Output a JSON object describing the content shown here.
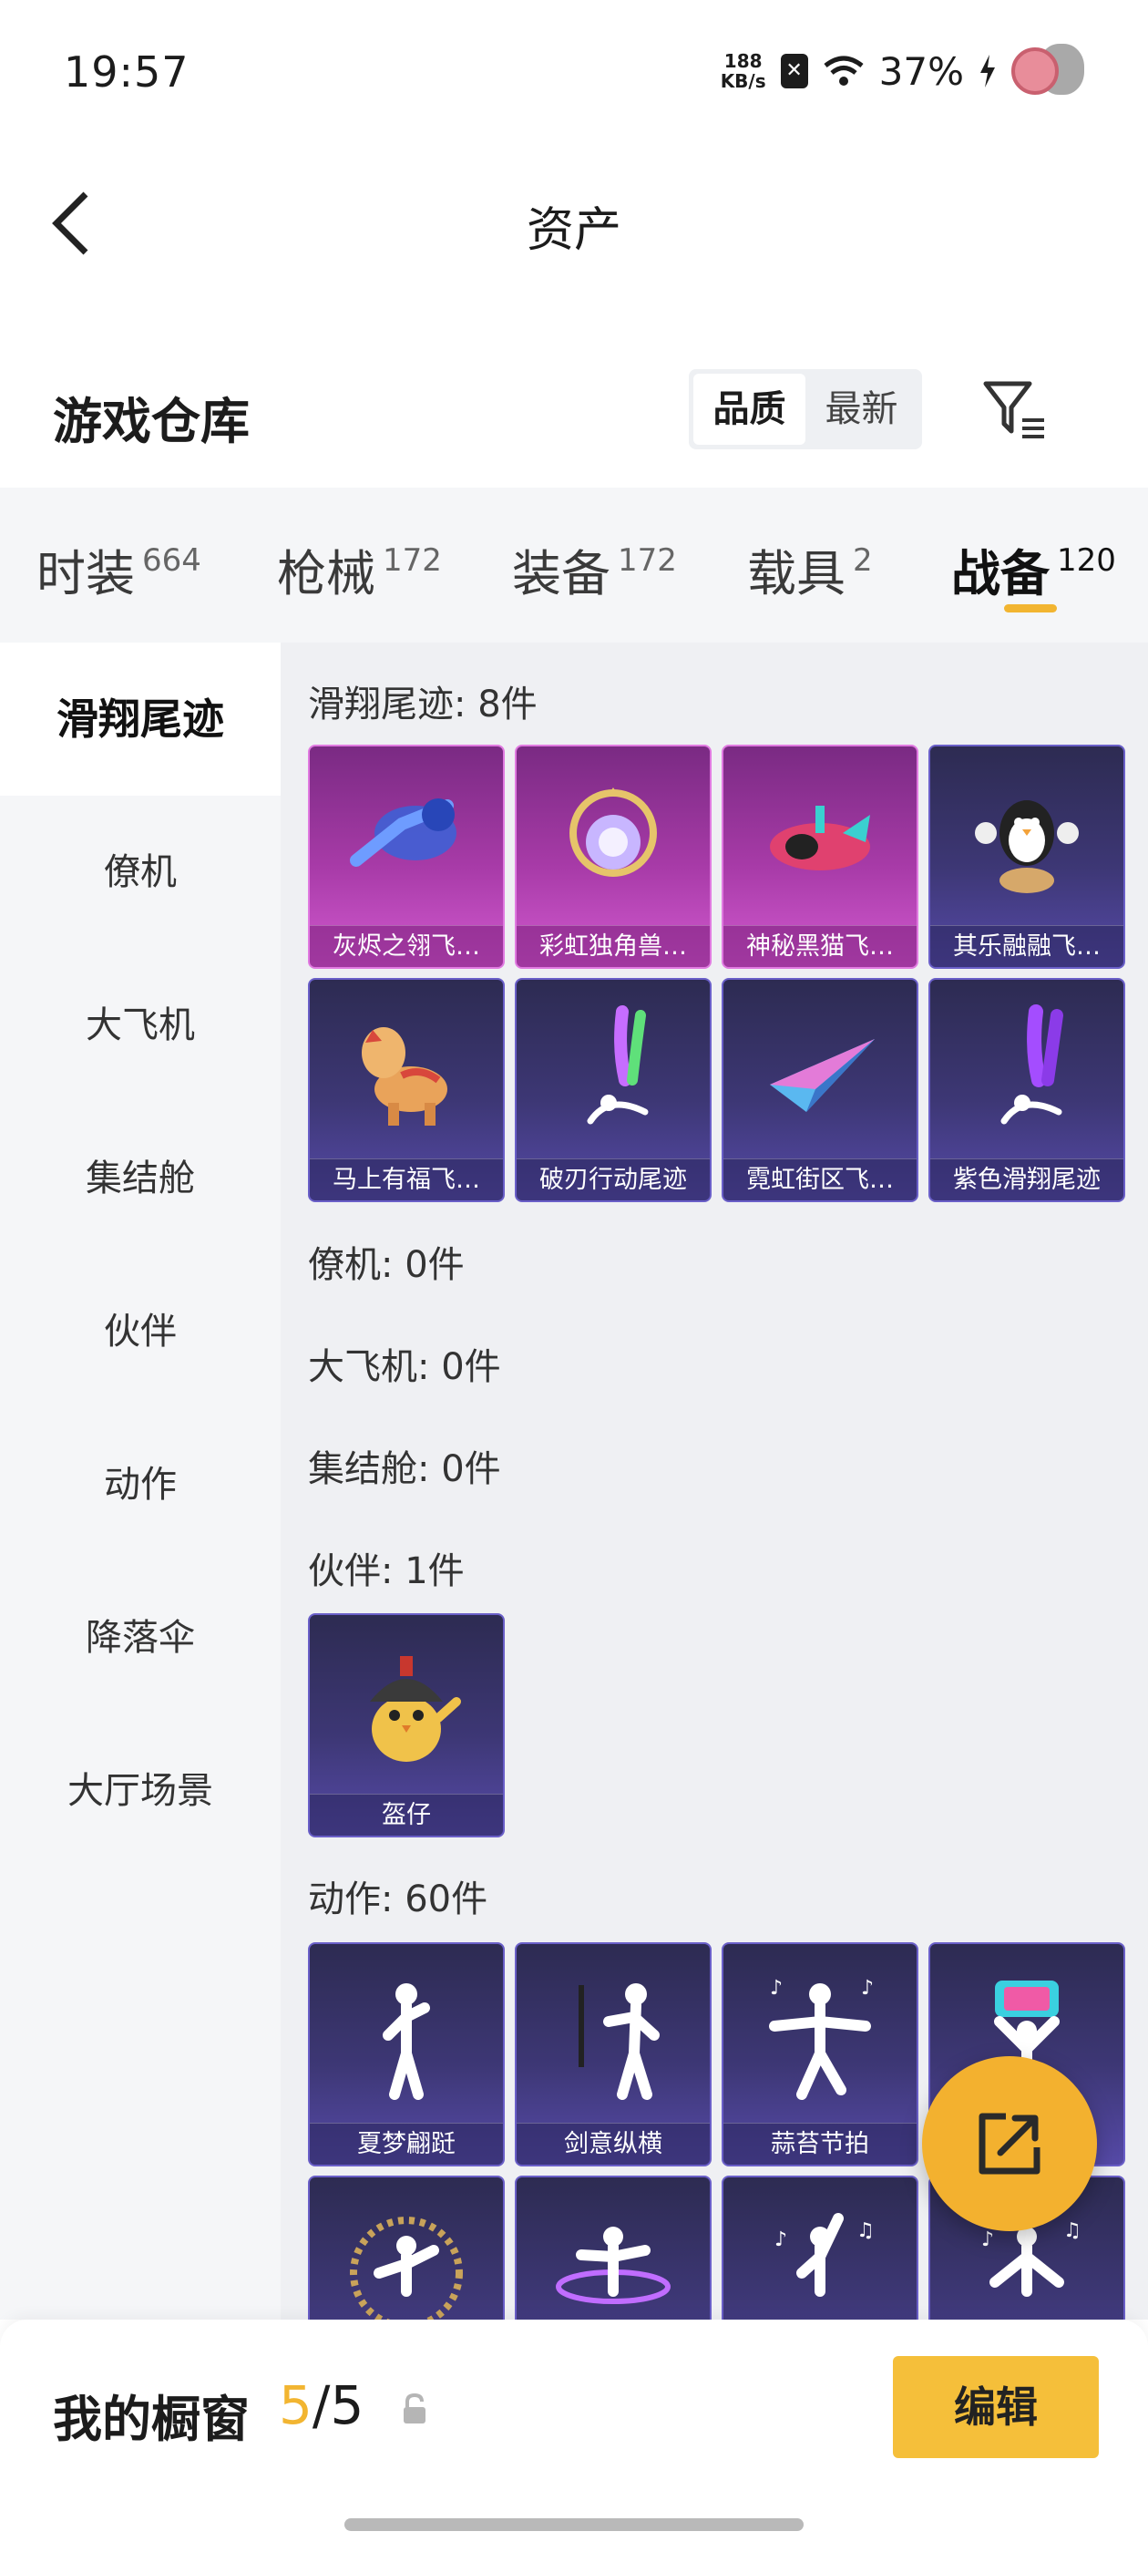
{
  "status_bar": {
    "time": "19:57",
    "net_speed_value": "188",
    "net_speed_unit": "KB/s",
    "battery": "37%",
    "icons": [
      "close-box-icon",
      "wifi-icon",
      "charging-icon",
      "avatar-icon"
    ]
  },
  "header": {
    "title": "资产",
    "back_icon": "chevron-left-icon"
  },
  "warehouse": {
    "title": "游戏仓库",
    "sort_options": [
      "品质",
      "最新"
    ],
    "sort_selected": "品质",
    "filter_icon": "filter-icon"
  },
  "tabs": [
    {
      "label": "时装",
      "count": "664"
    },
    {
      "label": "枪械",
      "count": "172"
    },
    {
      "label": "装备",
      "count": "172"
    },
    {
      "label": "载具",
      "count": "2"
    },
    {
      "label": "战备",
      "count": "120",
      "active": true
    }
  ],
  "sidebar": [
    {
      "label": "滑翔尾迹",
      "active": true
    },
    {
      "label": "僚机"
    },
    {
      "label": "大飞机"
    },
    {
      "label": "集结舱"
    },
    {
      "label": "伙伴"
    },
    {
      "label": "动作"
    },
    {
      "label": "降落伞"
    },
    {
      "label": "大厅场景"
    }
  ],
  "sections": {
    "glide_trail": {
      "label": "滑翔尾迹: 8件",
      "items": [
        {
          "name": "灰烬之翎飞…",
          "rarity": "pink",
          "icon": "glove-icon"
        },
        {
          "name": "彩虹独角兽…",
          "rarity": "pink",
          "icon": "gem-icon"
        },
        {
          "name": "神秘黑猫飞…",
          "rarity": "pink",
          "icon": "plane-icon"
        },
        {
          "name": "其乐融融飞…",
          "rarity": "purple",
          "icon": "penguin-icon"
        },
        {
          "name": "马上有福飞…",
          "rarity": "purple",
          "icon": "horse-icon"
        },
        {
          "name": "破刃行动尾迹",
          "rarity": "purple",
          "icon": "smoke-trail-icon"
        },
        {
          "name": "霓虹街区飞…",
          "rarity": "purple",
          "icon": "paper-plane-icon"
        },
        {
          "name": "紫色滑翔尾迹",
          "rarity": "purple",
          "icon": "smoke-trail-icon"
        }
      ]
    },
    "wingman": {
      "label": "僚机: 0件"
    },
    "big_plane": {
      "label": "大飞机: 0件"
    },
    "pod": {
      "label": "集结舱: 0件"
    },
    "partner": {
      "label": "伙伴: 1件",
      "items": [
        {
          "name": "盔仔",
          "rarity": "purple",
          "icon": "chick-helmet-icon"
        }
      ]
    },
    "emote": {
      "label": "动作: 60件",
      "items": [
        {
          "name": "夏梦翩跹",
          "rarity": "purple",
          "icon": "dancer-icon"
        },
        {
          "name": "剑意纵横",
          "rarity": "purple",
          "icon": "sword-dancer-icon"
        },
        {
          "name": "蒜苔节拍",
          "rarity": "purple",
          "icon": "music-dancer-icon"
        },
        {
          "name": "",
          "rarity": "purple",
          "icon": "sign-dancer-icon"
        },
        {
          "name": "",
          "rarity": "purple",
          "icon": "circle-dancer-icon"
        },
        {
          "name": "",
          "rarity": "purple",
          "icon": "spin-dancer-icon"
        },
        {
          "name": "",
          "rarity": "purple",
          "icon": "music-dancer-icon"
        },
        {
          "name": "",
          "rarity": "purple",
          "icon": "music-dancer-icon"
        }
      ]
    }
  },
  "fab_icon": "share-out-icon",
  "bottom": {
    "showcase_label": "我的橱窗",
    "showcase_current": "5",
    "showcase_total": "/5",
    "lock_icon": "lock-icon",
    "edit_label": "编辑"
  }
}
